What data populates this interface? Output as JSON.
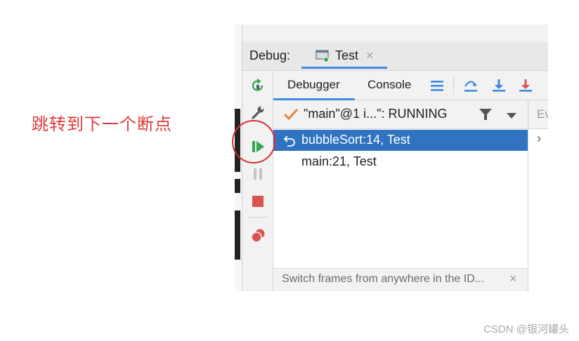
{
  "annotation": {
    "text": "跳转到下一个断点",
    "color": "#e03a3a"
  },
  "watermark": {
    "text": "CSDN @银河罐头"
  },
  "debug_panel": {
    "title": "Debug:",
    "tab": {
      "label": "Test",
      "close_glyph": "×"
    },
    "subtabs": [
      {
        "label": "Debugger",
        "active": true
      },
      {
        "label": "Console",
        "active": false
      }
    ],
    "subtoolbar_icons": [
      "layout-lines-icon",
      "step-over-icon",
      "step-into-icon",
      "force-step-into-icon"
    ],
    "left_toolbar": {
      "icons": [
        "rerun-icon",
        "settings-wrench-icon",
        "resume-program-icon",
        "pause-icon",
        "stop-icon",
        "view-breakpoints-icon"
      ],
      "more_glyph": "››"
    },
    "thread": {
      "label": "\"main\"@1 i...\": RUNNING"
    },
    "frames": [
      {
        "label": "bubbleSort:14, Test",
        "selected": true
      },
      {
        "label": "main:21, Test",
        "selected": false
      }
    ],
    "hint": {
      "text": "Switch frames from anywhere in the ID...",
      "close_glyph": "×"
    },
    "variables_header": "Ev",
    "expand_glyph": "›"
  },
  "colors": {
    "accent": "#3d8be0",
    "selection": "#2f73c1",
    "resume_green": "#36a554",
    "stop_red": "#d9534f"
  }
}
